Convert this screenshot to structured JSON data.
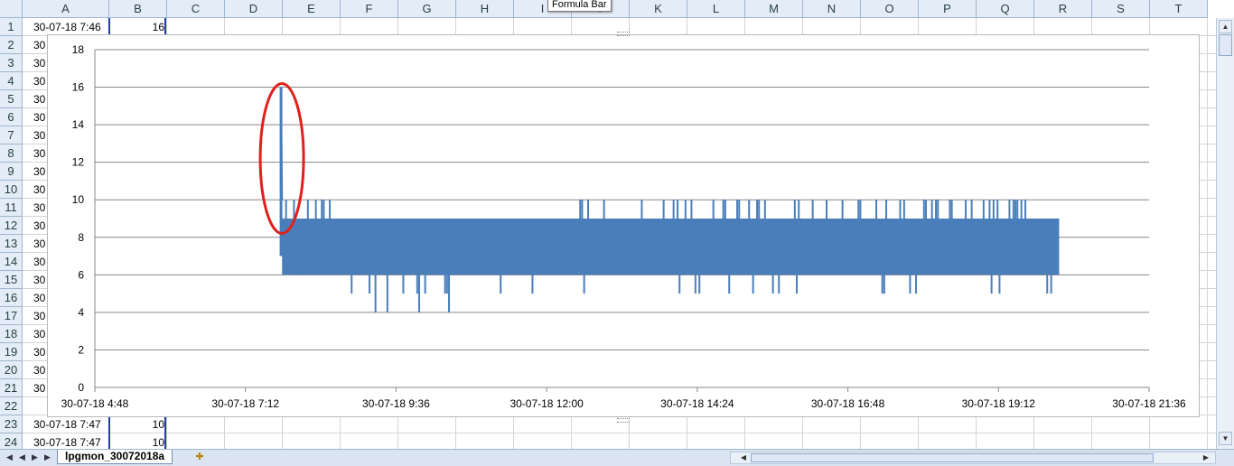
{
  "tooltip": {
    "text": "Formula Bar"
  },
  "columns": [
    "A",
    "B",
    "C",
    "D",
    "E",
    "F",
    "G",
    "H",
    "I",
    "J",
    "K",
    "L",
    "M",
    "N",
    "O",
    "P",
    "Q",
    "R",
    "S",
    "T"
  ],
  "rows": [
    "1",
    "2",
    "3",
    "4",
    "5",
    "6",
    "7",
    "8",
    "9",
    "10",
    "11",
    "12",
    "13",
    "14",
    "15",
    "16",
    "17",
    "18",
    "19",
    "20",
    "21",
    "22",
    "23",
    "24"
  ],
  "cells": {
    "r1": {
      "a": "30-07-18 7:46",
      "b": "16"
    },
    "r23": {
      "a": "30-07-18 7:47",
      "b": "10"
    },
    "r24": {
      "a": "30-07-18 7:47",
      "b": "10"
    },
    "partial_a": "30"
  },
  "sheet_tab": {
    "name": "lpgmon_30072018a"
  },
  "colors": {
    "series": "#4a7ebb",
    "highlight": "#e0201c",
    "gridline": "#878787"
  },
  "chart_data": {
    "type": "line",
    "title": "",
    "xlabel": "",
    "ylabel": "",
    "x_ticks": [
      "30-07-18 4:48",
      "30-07-18 7:12",
      "30-07-18 9:36",
      "30-07-18 12:00",
      "30-07-18 14:24",
      "30-07-18 16:48",
      "30-07-18 19:12",
      "30-07-18 21:36"
    ],
    "y_ticks": [
      "0",
      "2",
      "4",
      "6",
      "8",
      "10",
      "12",
      "14",
      "16",
      "18"
    ],
    "ylim": [
      0,
      18
    ],
    "xlim": [
      "30-07-18 4:48",
      "30-07-18 21:36"
    ],
    "grid": "horizontal major gridlines",
    "legend": "none",
    "series": [
      {
        "x": [
          "30-07-18 7:46",
          "30-07-18 7:47",
          "30-07-18 7:50",
          "30-07-18 8:15",
          "30-07-18 8:45",
          "30-07-18 9:15",
          "30-07-18 9:45",
          "30-07-18 10:30",
          "30-07-18 11:30",
          "30-07-18 12:30",
          "30-07-18 13:30",
          "30-07-18 14:30",
          "30-07-18 15:30",
          "30-07-18 16:30",
          "30-07-18 17:30",
          "30-07-18 18:30",
          "30-07-18 19:30",
          "30-07-18 20:10"
        ],
        "y": [
          16,
          10,
          8,
          8,
          7,
          7,
          7,
          7,
          7,
          8,
          8,
          8,
          8,
          8,
          8,
          8,
          8,
          8
        ],
        "y_min": [
          7,
          6,
          6,
          6,
          5,
          4,
          4,
          5,
          5,
          5,
          5,
          5,
          5,
          5,
          5,
          5,
          5,
          6
        ],
        "y_max": [
          16,
          10,
          10,
          10,
          9,
          9,
          9,
          9,
          9,
          10,
          10,
          10,
          10,
          10,
          10,
          10,
          10,
          9
        ]
      }
    ],
    "annotations": [
      {
        "type": "ellipse",
        "shape": "red oval around initial spike",
        "x": "30-07-18 7:46",
        "y": 16
      }
    ]
  }
}
